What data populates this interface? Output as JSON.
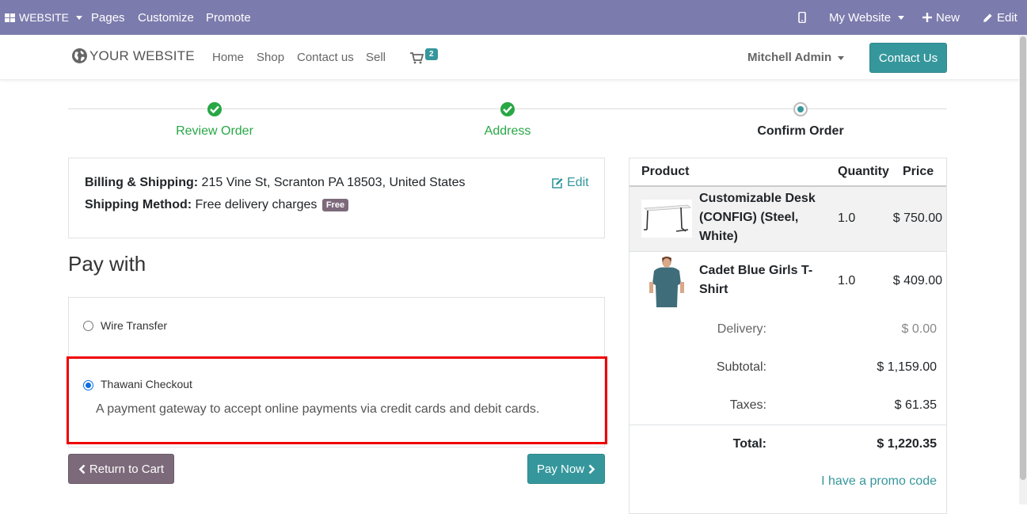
{
  "topbar": {
    "website_label": "WEBSITE",
    "pages": "Pages",
    "customize": "Customize",
    "promote": "Promote",
    "my_website": "My Website",
    "new": "New",
    "edit": "Edit"
  },
  "navbar": {
    "logo_text": "YOUR WEBSITE",
    "links": [
      "Home",
      "Shop",
      "Contact us",
      "Sell"
    ],
    "cart_count": "2",
    "user": "Mitchell Admin",
    "contact_button": "Contact Us"
  },
  "progress": {
    "steps": [
      "Review Order",
      "Address",
      "Confirm Order"
    ],
    "current_step": 3
  },
  "billing": {
    "label": "Billing & Shipping:",
    "address": "215 Vine St, Scranton PA 18503, United States",
    "method_label": "Shipping Method:",
    "method": "Free delivery charges",
    "badge": "Free",
    "edit": "Edit"
  },
  "payment": {
    "heading": "Pay with",
    "options": [
      {
        "label": "Wire Transfer",
        "selected": false
      },
      {
        "label": "Thawani Checkout",
        "selected": true,
        "description": "A payment gateway to accept online payments via credit cards and debit cards."
      }
    ],
    "return_button": "Return to Cart",
    "pay_button": "Pay Now"
  },
  "summary": {
    "headers": [
      "Product",
      "Quantity",
      "Price"
    ],
    "items": [
      {
        "name": "Customizable Desk (CONFIG) (Steel, White)",
        "quantity": "1.0",
        "price": "$ 750.00"
      },
      {
        "name": "Cadet Blue Girls T-Shirt",
        "quantity": "1.0",
        "price": "$ 409.00"
      }
    ],
    "delivery_label": "Delivery:",
    "delivery": "$ 0.00",
    "subtotal_label": "Subtotal:",
    "subtotal": "$ 1,159.00",
    "taxes_label": "Taxes:",
    "taxes": "$ 61.35",
    "total_label": "Total:",
    "total": "$ 1,220.35",
    "promo": "I have a promo code"
  },
  "colors": {
    "topbar": "#7c7bad",
    "primary": "#35979c",
    "secondary": "#7c6a7a",
    "success": "#28a745",
    "highlight": "#ee0000"
  }
}
